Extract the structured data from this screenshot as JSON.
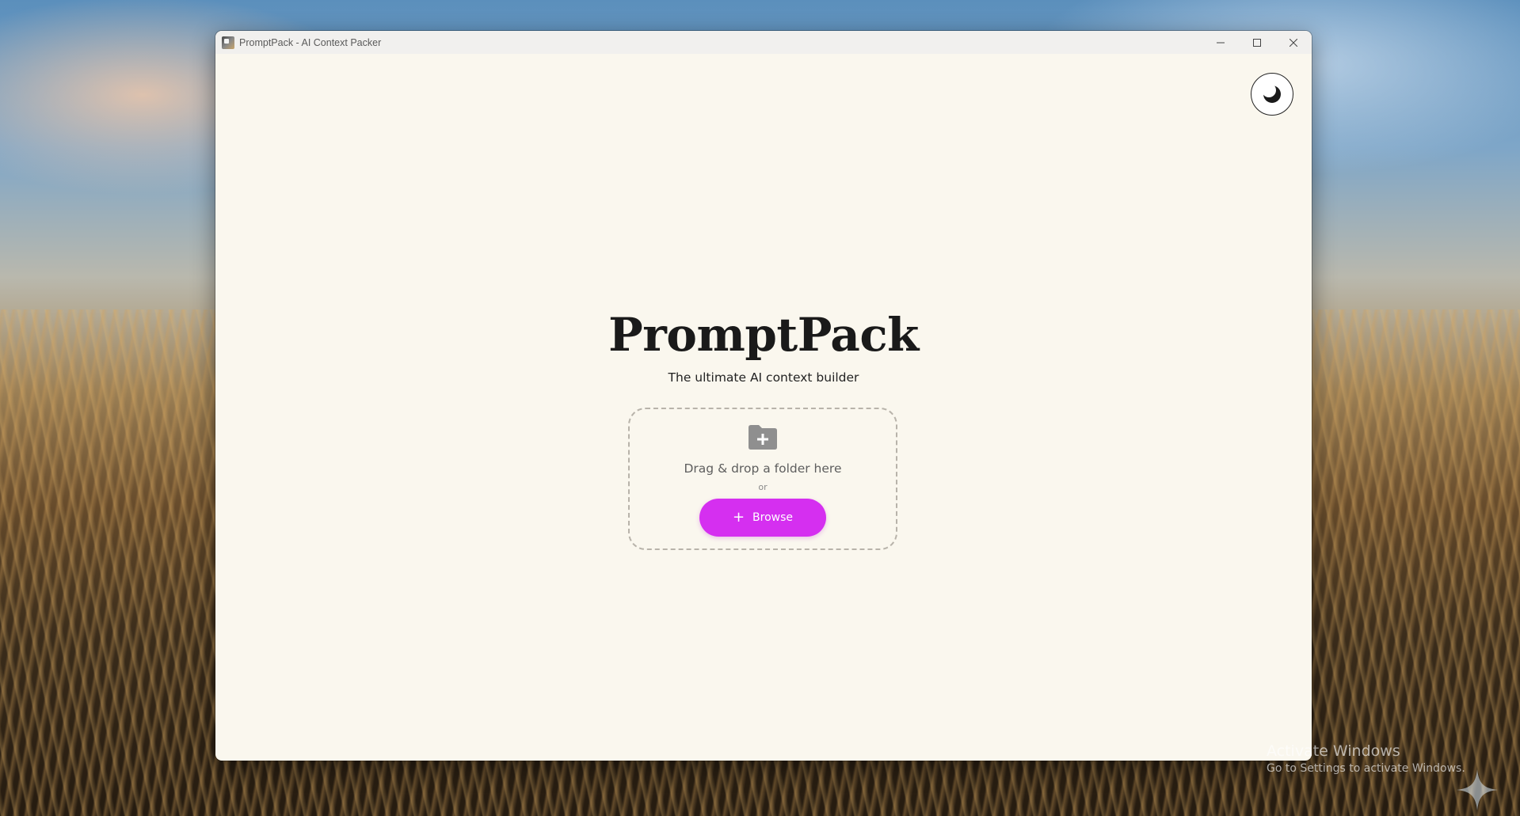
{
  "window": {
    "title": "PromptPack - AI Context Packer",
    "controls": {
      "minimize_icon": "minimize-icon",
      "maximize_icon": "maximize-icon",
      "close_icon": "close-icon"
    }
  },
  "header": {
    "theme_toggle_icon": "moon-icon"
  },
  "hero": {
    "title": "PromptPack",
    "tagline": "The ultimate AI context builder"
  },
  "dropzone": {
    "icon": "folder-plus-icon",
    "text": "Drag & drop a folder here",
    "or_text": "or",
    "browse_label": "Browse",
    "browse_icon": "plus-icon"
  },
  "os": {
    "activation_title": "Activate Windows",
    "activation_subtitle": "Go to Settings to activate Windows."
  },
  "colors": {
    "window_bg": "#faf7ee",
    "accent": "#d52ff0",
    "text_dark": "#1a1a1a",
    "dropzone_border": "#b8b3aa"
  }
}
